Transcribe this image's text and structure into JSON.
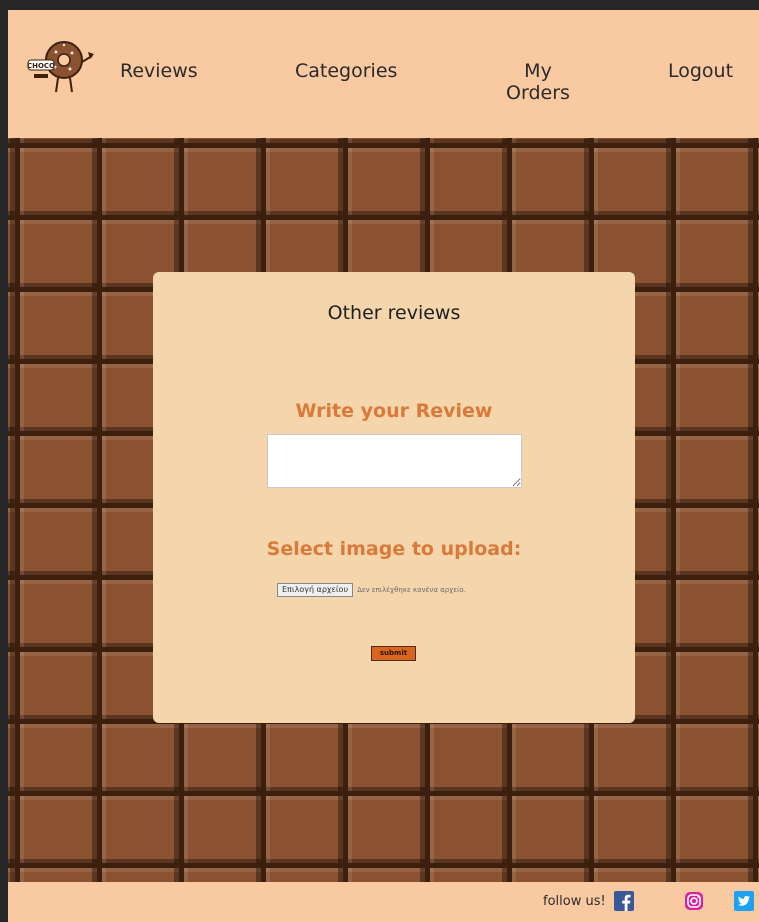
{
  "header": {
    "logo_text": "CHOCO",
    "nav": {
      "reviews": "Reviews",
      "categories": "Categories",
      "orders": "My\nOrders",
      "logout": "Logout"
    }
  },
  "modal": {
    "title": "Other reviews",
    "write_heading": "Write your Review",
    "review_value": "",
    "upload_heading": "Select image to upload:",
    "file_button": "Επιλογή αρχείου",
    "file_status": "Δεν επιλέχθηκε κανένα αρχείο.",
    "submit_label": "submit"
  },
  "footer": {
    "follow_text": "follow us!",
    "icons": [
      "facebook-icon",
      "instagram-icon",
      "twitter-icon"
    ]
  },
  "colors": {
    "header_bg": "#f9c9a1",
    "modal_bg": "#f4d5ac",
    "heading_orange": "#d97a3a",
    "submit_bg": "#d9661f",
    "chocolate": "#8a5230"
  }
}
